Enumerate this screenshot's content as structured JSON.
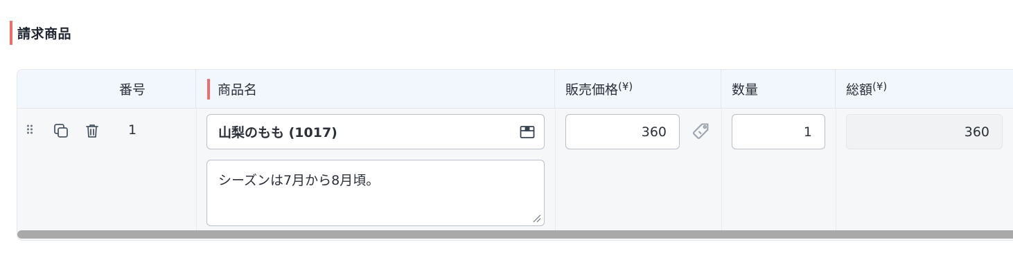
{
  "section": {
    "title": "請求商品"
  },
  "table": {
    "headers": {
      "no": "番号",
      "name": "商品名",
      "price": "販売価格",
      "price_unit": "(¥)",
      "qty": "数量",
      "total": "総額",
      "total_unit": "(¥)"
    },
    "rows": [
      {
        "no": "1",
        "name": "山梨のもも (1017)",
        "description": "シーズンは7月から8月頃。",
        "price": "360",
        "qty": "1",
        "total": "360"
      }
    ]
  },
  "colors": {
    "accent": "#f26b6b",
    "header_bg": "#f2f6fd",
    "row_bg": "#f6f7f9",
    "scrollbar": "#a9a9a9"
  },
  "icons": {
    "drag": "drag-handle-icon",
    "copy": "copy-icon",
    "delete": "trash-icon",
    "product_picker": "box-icon",
    "price_tag": "price-tag-icon"
  }
}
